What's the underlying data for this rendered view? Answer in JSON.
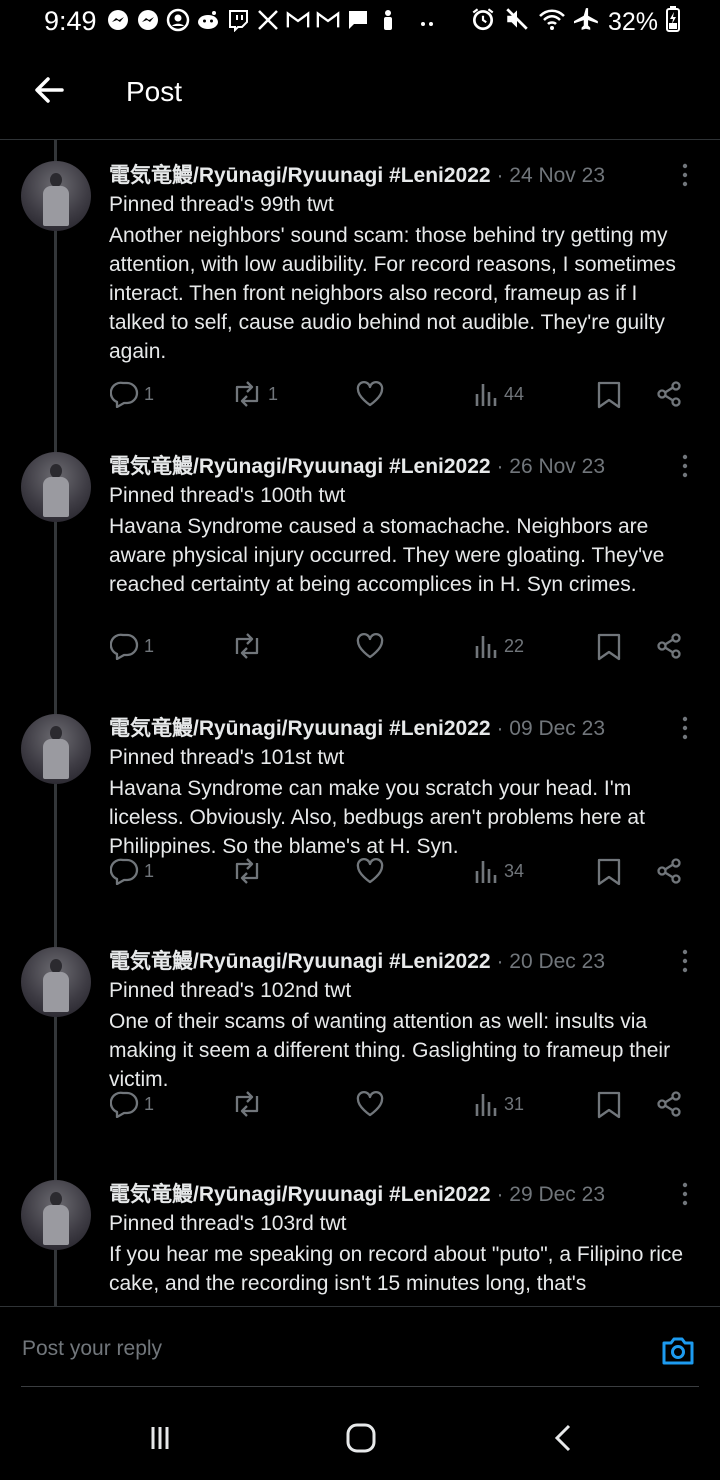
{
  "status_bar": {
    "time": "9:49",
    "battery": "32%",
    "left_icons": [
      "messenger-icon",
      "messenger-icon",
      "account-icon",
      "reddit-icon",
      "twitch-icon",
      "x-icon",
      "gmail-icon",
      "gmail-icon",
      "chat-icon",
      "person-icon",
      "more-dots-icon"
    ],
    "right_icons": [
      "alarm-icon",
      "mute-icon",
      "wifi-icon",
      "airplane-icon",
      "battery-icon"
    ]
  },
  "header": {
    "title": "Post",
    "back_icon": "arrow-left-icon"
  },
  "posts": [
    {
      "author": "電気竜鰻/Ryūnagi/Ryuunagi #Leni2022",
      "date": "· 24 Nov 23",
      "subtitle": "Pinned thread's 99th twt",
      "text": "Another neighbors' sound scam: those behind try getting my attention, with low audibility. For record reasons, I sometimes interact. Then front neighbors also record, frameup as if I talked to self, cause audio behind not audible. They're guilty again.",
      "replies": "1",
      "reposts": "1",
      "likes": "",
      "views": "44"
    },
    {
      "author": "電気竜鰻/Ryūnagi/Ryuunagi #Leni2022",
      "date": "· 26 Nov 23",
      "subtitle": "Pinned thread's 100th twt",
      "text": "Havana Syndrome caused a stomachache. Neighbors are aware physical injury occurred. They were gloating. They've reached certainty at being accomplices in H. Syn crimes.",
      "replies": "1",
      "reposts": "",
      "likes": "",
      "views": "22"
    },
    {
      "author": "電気竜鰻/Ryūnagi/Ryuunagi #Leni2022",
      "date": "· 09 Dec 23",
      "subtitle": "Pinned thread's 101st twt",
      "text": "Havana Syndrome can make you scratch your head. I'm liceless. Obviously. Also, bedbugs aren't problems here at Philippines. So the blame's at H. Syn.",
      "replies": "1",
      "reposts": "",
      "likes": "",
      "views": "34"
    },
    {
      "author": "電気竜鰻/Ryūnagi/Ryuunagi #Leni2022",
      "date": "· 20 Dec 23",
      "subtitle": "Pinned thread's 102nd twt",
      "text": "One of their scams of wanting attention as well: insults via making it seem a different thing. Gaslighting to frameup their victim.",
      "replies": "1",
      "reposts": "",
      "likes": "",
      "views": "31"
    },
    {
      "author": "電気竜鰻/Ryūnagi/Ryuunagi #Leni2022",
      "date": "· 29 Dec 23",
      "subtitle": "Pinned thread's 103rd twt",
      "text": "If you hear me speaking on record about \"puto\", a Filipino rice cake, and the recording isn't 15 minutes long, that's",
      "replies": "",
      "reposts": "",
      "likes": "",
      "views": ""
    }
  ],
  "reply_bar": {
    "placeholder": "Post your reply",
    "camera_icon": "camera-icon"
  },
  "nav_bar": {
    "icons": [
      "recents-icon",
      "home-icon",
      "back-icon"
    ]
  },
  "colors": {
    "background": "#000000",
    "text": "#e7e9ea",
    "muted": "#71767b",
    "accent": "#1d9bf0",
    "divider": "#2f3336"
  }
}
